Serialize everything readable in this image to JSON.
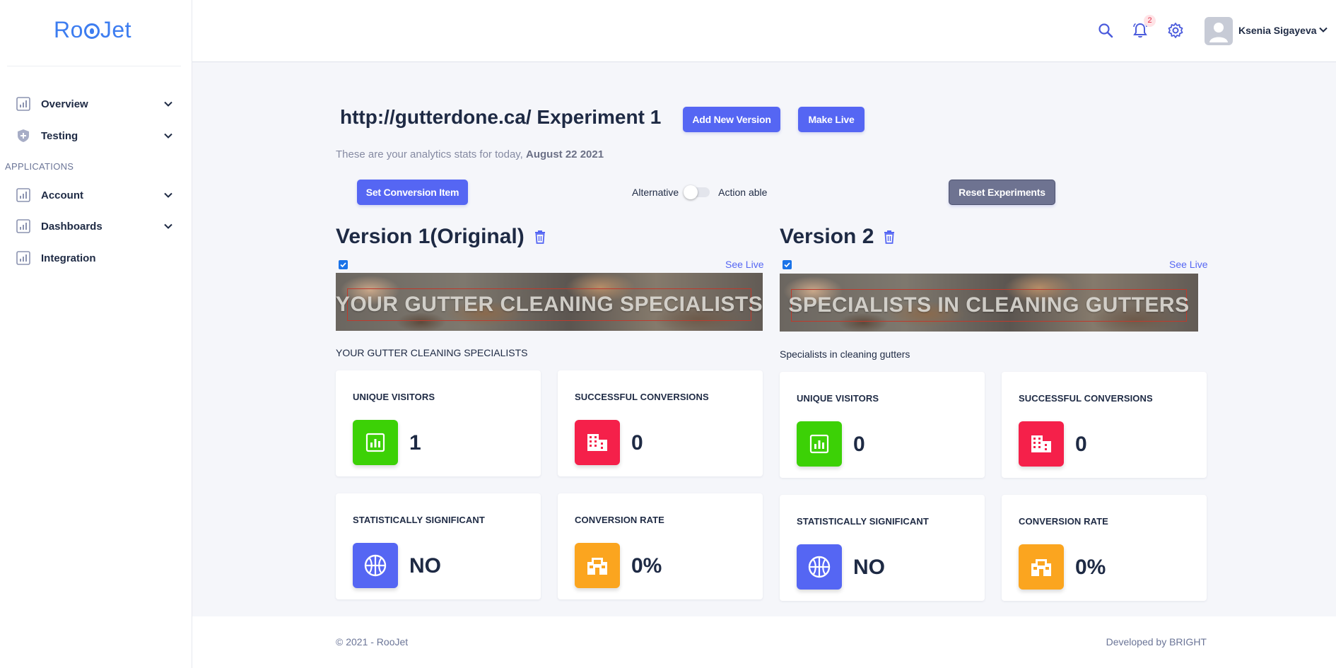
{
  "app": {
    "logo": "RooJet"
  },
  "sidebar": {
    "items": [
      {
        "label": "Overview",
        "icon": "chart-icon",
        "has_chevron": true
      },
      {
        "label": "Testing",
        "icon": "shield-icon",
        "has_chevron": true
      },
      {
        "label": "Account",
        "icon": "chart-icon",
        "has_chevron": true
      },
      {
        "label": "Dashboards",
        "icon": "chart-icon",
        "has_chevron": true
      },
      {
        "label": "Integration",
        "icon": "chart-icon",
        "has_chevron": false
      }
    ],
    "section_label": "APPLICATIONS"
  },
  "header": {
    "notifications_count": "2",
    "user_name": "Ksenia Sigayeva"
  },
  "main": {
    "title": "http://gutterdone.ca/ Experiment 1",
    "add_version_label": "Add New Version",
    "make_live_label": "Make Live",
    "subtitle_prefix": "These are your analytics stats for today,",
    "subtitle_date": "August 22 2021",
    "set_conversion_label": "Set Conversion Item",
    "toggle_left_label": "Alternative",
    "toggle_right_label": "Action able",
    "reset_label": "Reset Experiments"
  },
  "versions": [
    {
      "title": "Version 1(Original)",
      "see_live": "See Live",
      "banner_text": "YOUR GUTTER CLEANING SPECIALISTS",
      "caption": "YOUR GUTTER CLEANING SPECIALISTS",
      "checked": true,
      "stats": [
        {
          "label": "UNIQUE VISITORS",
          "value": "1",
          "icon": "bar-chart-icon",
          "color": "#3cd106"
        },
        {
          "label": "SUCCESSFUL CONVERSIONS",
          "value": "0",
          "icon": "building-icon",
          "color": "#f5204a"
        },
        {
          "label": "STATISTICALLY SIGNIFICANT",
          "value": "NO",
          "icon": "basketball-icon",
          "color": "#5566f3"
        },
        {
          "label": "CONVERSION RATE",
          "value": "0%",
          "icon": "store-24-icon",
          "color": "#fba51f"
        }
      ]
    },
    {
      "title": "Version 2",
      "see_live": "See Live",
      "banner_text": "SPECIALISTS IN CLEANING GUTTERS",
      "caption": "Specialists in cleaning gutters",
      "checked": true,
      "stats": [
        {
          "label": "UNIQUE VISITORS",
          "value": "0",
          "icon": "bar-chart-icon",
          "color": "#3cd106"
        },
        {
          "label": "SUCCESSFUL CONVERSIONS",
          "value": "0",
          "icon": "building-icon",
          "color": "#f5204a"
        },
        {
          "label": "STATISTICALLY SIGNIFICANT",
          "value": "NO",
          "icon": "basketball-icon",
          "color": "#5566f3"
        },
        {
          "label": "CONVERSION RATE",
          "value": "0%",
          "icon": "store-24-icon",
          "color": "#fba51f"
        }
      ]
    }
  ],
  "footer": {
    "copyright": "© 2021 - RooJet",
    "developer": "Developed by BRIGHT"
  },
  "colors": {
    "accent": "#5566f3",
    "logo": "#3d7df0",
    "reset_button": "#6e7391"
  }
}
